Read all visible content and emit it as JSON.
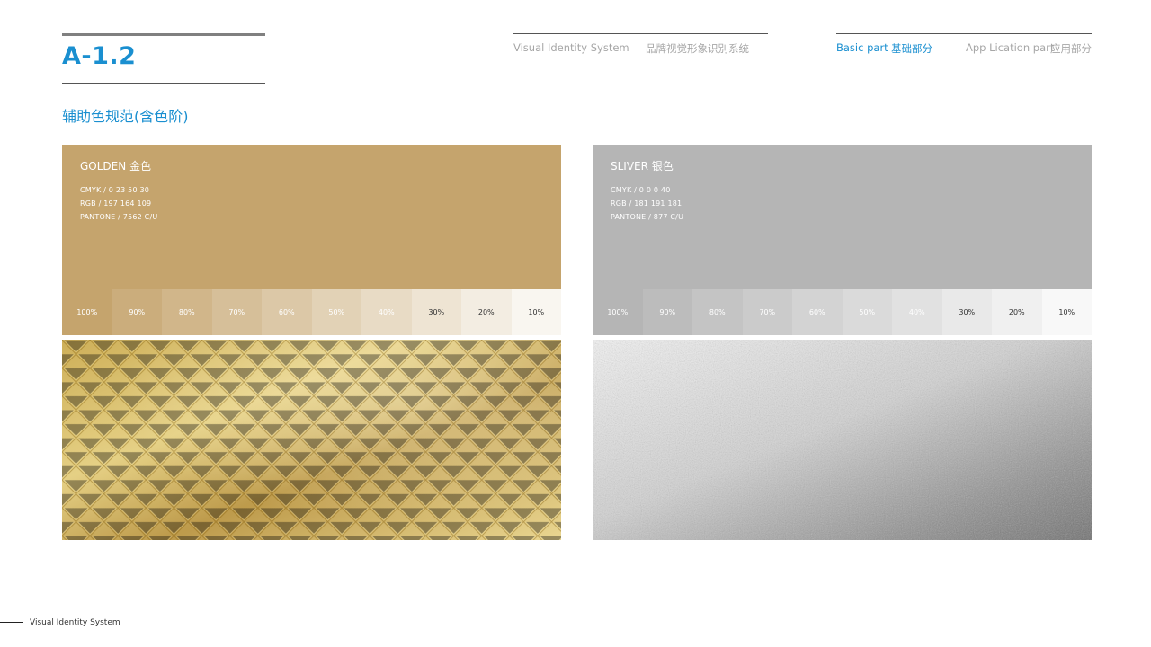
{
  "page": {
    "code": "A-1.2",
    "subtitle": "辅助色规范(含色阶)"
  },
  "header": {
    "system_en": "Visual Identity System",
    "system_cn": "品牌视觉形象识别系统",
    "basic_en": "Basic part",
    "basic_cn": "基础部分",
    "app_en": "App Lication part",
    "app_cn": "应用部分"
  },
  "colors": [
    {
      "name": "GOLDEN 金色",
      "cmyk": "CMYK  /  0  23  50  30",
      "rgb": "RGB  /  197  164  109",
      "pantone": "PANTONE  /  7562 C/U",
      "hex": "#c5a46d",
      "tints": [
        "100%",
        "90%",
        "80%",
        "70%",
        "60%",
        "50%",
        "40%",
        "30%",
        "20%",
        "10%"
      ]
    },
    {
      "name": "SLIVER 银色",
      "cmyk": "CMYK  /  0  0  0  40",
      "rgb": "RGB  /  181  191  181",
      "pantone": "PANTONE  /  877 C/U",
      "hex": "#b5b5b5",
      "tints": [
        "100%",
        "90%",
        "80%",
        "70%",
        "60%",
        "50%",
        "40%",
        "30%",
        "20%",
        "10%"
      ]
    }
  ],
  "footer": {
    "text": "Visual Identity System"
  }
}
